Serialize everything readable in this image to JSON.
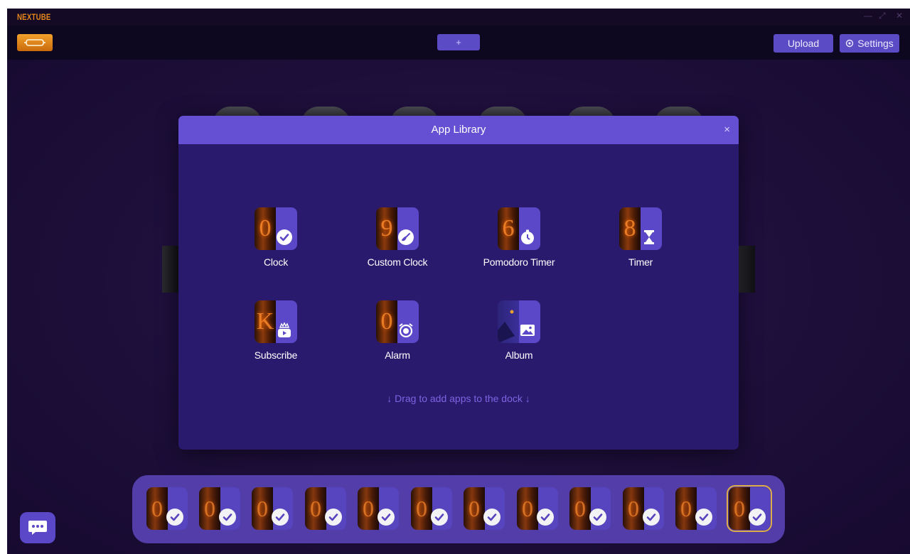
{
  "window": {
    "app_name": "NEXTUBE",
    "controls": [
      "—",
      "⤢",
      "✕"
    ]
  },
  "toolbar": {
    "add_label": "+",
    "upload_label": "Upload",
    "settings_label": "Settings"
  },
  "modal": {
    "title": "App Library",
    "close_label": "×",
    "apps": [
      {
        "label": "Clock",
        "glyph": "0",
        "icon": "check-icon"
      },
      {
        "label": "Custom Clock",
        "glyph": "9",
        "icon": "custom-brush-icon"
      },
      {
        "label": "Pomodoro Timer",
        "glyph": "6",
        "icon": "stopwatch-icon"
      },
      {
        "label": "Timer",
        "glyph": "8",
        "icon": "hourglass-icon"
      },
      {
        "label": "Subscribe",
        "glyph": "K",
        "icon": "youtube-crown-icon"
      },
      {
        "label": "Alarm",
        "glyph": "0",
        "icon": "alarm-clock-icon"
      },
      {
        "label": "Album",
        "glyph": "",
        "icon": "image-icon"
      }
    ],
    "drag_hint": "↓ Drag to add apps to the dock ↓"
  },
  "dock": {
    "count": 12,
    "selected_index": 11,
    "item_icon": "check-icon"
  },
  "colors": {
    "accent": "#6550d3",
    "background": "#1c0e38",
    "orange": "#e8891a",
    "dock": "#5640b0"
  }
}
